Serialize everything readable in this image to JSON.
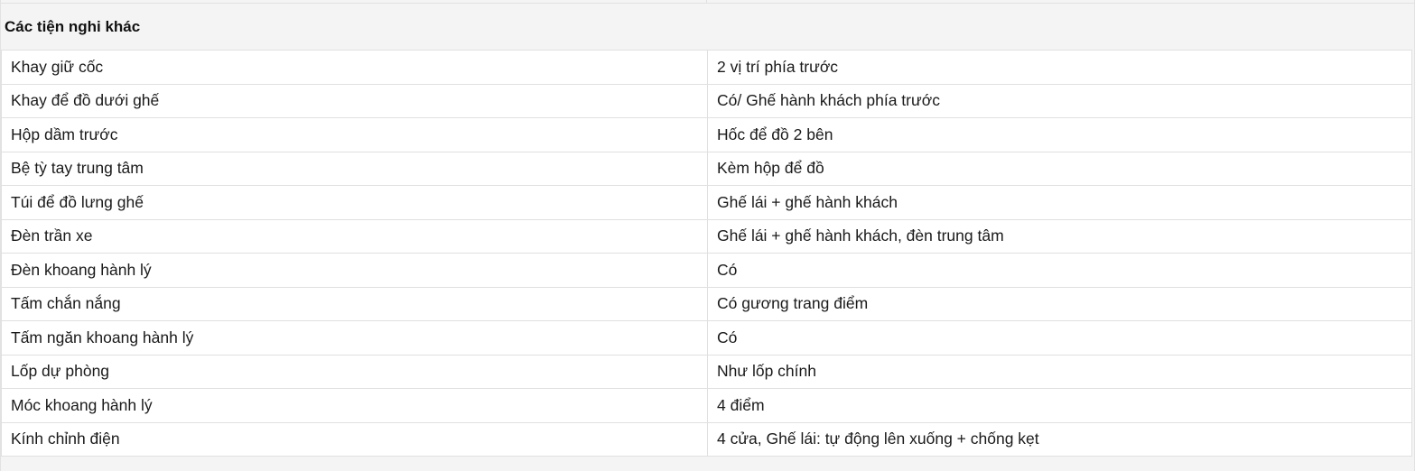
{
  "section": {
    "title": "Các tiện nghi khác"
  },
  "rows": [
    {
      "name": "Khay giữ cốc",
      "value": "2 vị trí phía trước"
    },
    {
      "name": "Khay để đồ dưới ghế",
      "value": "Có/ Ghế hành khách phía trước"
    },
    {
      "name": "Hộp dầm trước",
      "value": "Hốc để đồ 2 bên"
    },
    {
      "name": "Bệ tỳ tay trung tâm",
      "value": "Kèm hộp để đồ"
    },
    {
      "name": "Túi để đồ lưng ghế",
      "value": "Ghế lái + ghế hành khách"
    },
    {
      "name": "Đèn trần xe",
      "value": "Ghế lái + ghế hành khách, đèn trung tâm"
    },
    {
      "name": "Đèn khoang hành lý",
      "value": "Có"
    },
    {
      "name": "Tấm chắn nắng",
      "value": "Có gương trang điểm"
    },
    {
      "name": "Tấm ngăn khoang hành lý",
      "value": "Có"
    },
    {
      "name": "Lốp dự phòng",
      "value": "Như lốp chính"
    },
    {
      "name": "Móc khoang hành lý",
      "value": "4 điểm"
    },
    {
      "name": "Kính chỉnh điện",
      "value": "4 cửa, Ghế lái: tự động lên xuống + chống kẹt"
    }
  ]
}
